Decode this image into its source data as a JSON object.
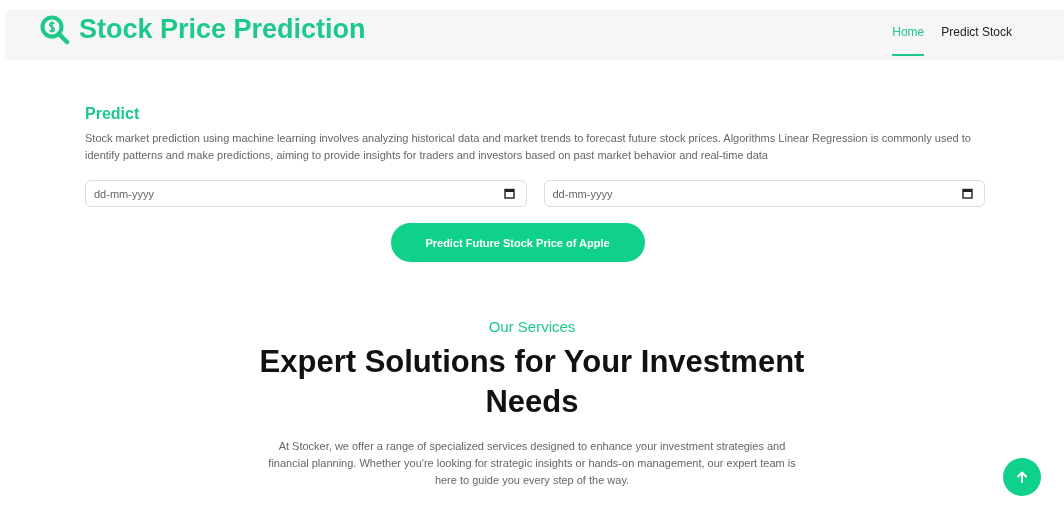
{
  "navbar": {
    "brand": "Stock Price Prediction",
    "links": [
      {
        "label": "Home",
        "selected": true
      },
      {
        "label": "Predict Stock",
        "selected": false
      }
    ]
  },
  "predict": {
    "heading": "Predict",
    "description": "Stock market prediction using machine learning involves analyzing historical data and market trends to forecast future stock prices. Algorithms Linear Regression is commonly used to identify patterns and make predictions, aiming to provide insights for traders and investors based on past market behavior and real-time data",
    "date_fields": [
      {
        "placeholder": "dd-mm-yyyy"
      },
      {
        "placeholder": "dd-mm-yyyy"
      }
    ],
    "button": "Predict Future Stock Price of Apple"
  },
  "services": {
    "eyebrow": "Our Services",
    "title": "Expert Solutions for Your Investment Needs",
    "description": "At Stocker, we offer a range of specialized services designed to enhance your investment strategies and financial planning. Whether you're looking for strategic insights or hands-on management, our expert team is here to guide you every step of the way."
  }
}
